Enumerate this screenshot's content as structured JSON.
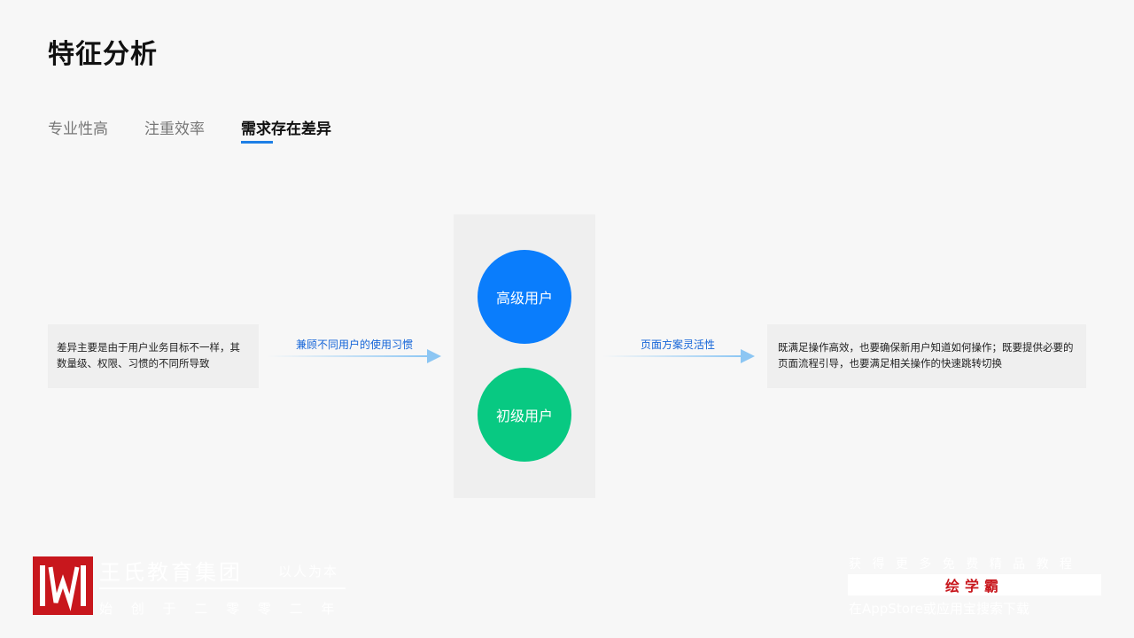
{
  "page": {
    "title": "特征分析"
  },
  "tabs": [
    {
      "label": "专业性高",
      "active": false
    },
    {
      "label": "注重效率",
      "active": false
    },
    {
      "label": "需求存在差异",
      "active": true
    }
  ],
  "left_box": {
    "text": "差异主要是由于用户业务目标不一样，其数量级、权限、习惯的不同所导致"
  },
  "arrow_left": {
    "label": "兼顾不同用户的使用习惯"
  },
  "users": {
    "advanced": {
      "label": "高级用户",
      "color": "#0a7dfc"
    },
    "beginner": {
      "label": "初级用户",
      "color": "#08c982"
    }
  },
  "arrow_right": {
    "label": "页面方案灵活性"
  },
  "right_box": {
    "text": "既满足操作高效，也要确保新用户知道如何操作；既要提供必要的页面流程引导，也要满足相关操作的快速跳转切换"
  },
  "watermark": {
    "org_name": "王氏教育集团",
    "slogan": "以人为本",
    "founded": "始 创 于 二 零 零 二 年",
    "promo_top": "获 得 更 多 免 费 精 品 教 程",
    "app_name": "绘学霸",
    "promo_bottom": "在AppStore或应用宝搜索下载"
  },
  "colors": {
    "accent": "#1e7fe6",
    "brand_red": "#c8171d"
  }
}
